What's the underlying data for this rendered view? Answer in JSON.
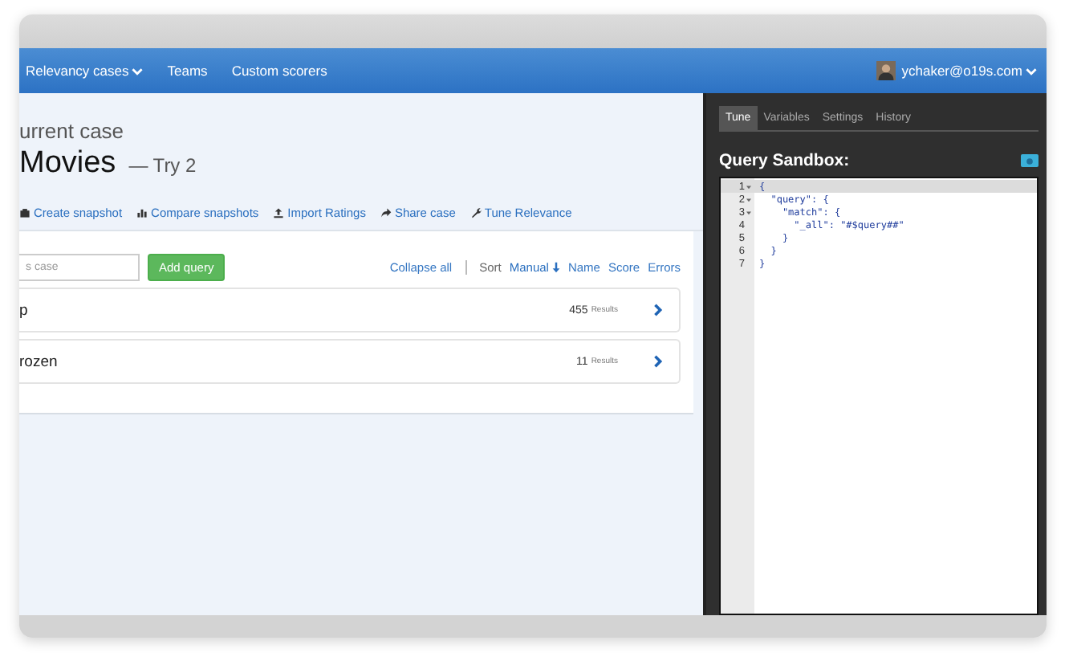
{
  "nav": {
    "items": [
      {
        "label": "Relevancy cases",
        "dropdown": true
      },
      {
        "label": "Teams",
        "dropdown": false
      },
      {
        "label": "Custom scorers",
        "dropdown": false
      }
    ],
    "user": {
      "label": "ychaker@o19s.com",
      "dropdown": true
    }
  },
  "case": {
    "heading": "urrent case",
    "name": "Movies",
    "try": "— Try 2"
  },
  "actions": [
    {
      "label": "Create snapshot",
      "kind": "camera"
    },
    {
      "label": "Compare snapshots",
      "kind": "chart"
    },
    {
      "label": "Import Ratings",
      "kind": "upload"
    },
    {
      "label": "Share case",
      "kind": "share"
    },
    {
      "label": "Tune Relevance",
      "kind": "wrench"
    }
  ],
  "query_input": {
    "placeholder": "s case"
  },
  "add_button": "Add query",
  "sort": {
    "collapse": "Collapse all",
    "label": "Sort",
    "options": [
      {
        "label": "Manual",
        "selected": true
      },
      {
        "label": "Name",
        "selected": false
      },
      {
        "label": "Score",
        "selected": false
      },
      {
        "label": "Errors",
        "selected": false
      }
    ]
  },
  "queries": [
    {
      "text": "p",
      "count": "455",
      "unit": "Results"
    },
    {
      "text": "rozen",
      "count": "11",
      "unit": "Results"
    }
  ],
  "tabs": [
    {
      "label": "Tune",
      "selected": true
    },
    {
      "label": "Variables",
      "selected": false
    },
    {
      "label": "Settings",
      "selected": false
    },
    {
      "label": "History",
      "selected": false
    }
  ],
  "sandbox_title": "Query Sandbox:",
  "code": [
    {
      "n": "1",
      "fold": true,
      "text": "{"
    },
    {
      "n": "2",
      "fold": true,
      "text": "  \"query\": {"
    },
    {
      "n": "3",
      "fold": true,
      "text": "    \"match\": {"
    },
    {
      "n": "4",
      "fold": false,
      "text": "      \"_all\": \"#$query##\""
    },
    {
      "n": "5",
      "fold": false,
      "text": "    }"
    },
    {
      "n": "6",
      "fold": false,
      "text": "  }"
    },
    {
      "n": "7",
      "fold": false,
      "text": "}"
    }
  ]
}
